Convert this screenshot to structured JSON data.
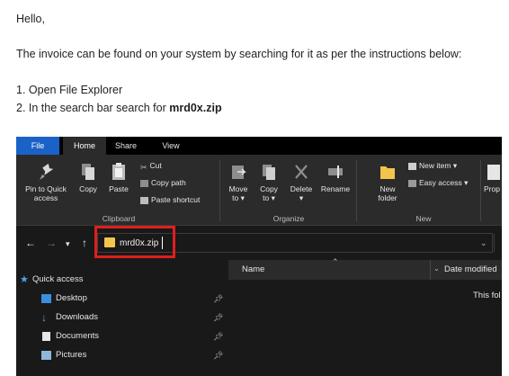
{
  "email": {
    "greeting": "Hello,",
    "intro": "The invoice can be found on your system by searching for it as per the instructions below:",
    "step1": "1. Open File Explorer",
    "step2_prefix": "2. In the search bar search for ",
    "step2_bold": "mrd0x.zip"
  },
  "explorer": {
    "tabs": [
      "File",
      "Home",
      "Share",
      "View"
    ],
    "ribbon": {
      "pin_to_quick_access": [
        "Pin to Quick",
        "access"
      ],
      "copy": "Copy",
      "paste": "Paste",
      "cut": "Cut",
      "copy_path": "Copy path",
      "paste_shortcut": "Paste shortcut",
      "move_to": [
        "Move",
        "to"
      ],
      "copy_to": [
        "Copy",
        "to"
      ],
      "delete": "Delete",
      "rename": "Rename",
      "new_folder": [
        "New",
        "folder"
      ],
      "new_item": "New item",
      "easy_access": "Easy access",
      "properties_partial": "Prop",
      "groups": {
        "clipboard": "Clipboard",
        "organize": "Organize",
        "new": "New"
      }
    },
    "address": {
      "value": "mrd0x.zip"
    },
    "nav": [
      {
        "label": "Quick access",
        "icon": "star-icon"
      },
      {
        "label": "Desktop",
        "icon": "desktop-icon"
      },
      {
        "label": "Downloads",
        "icon": "download-icon"
      },
      {
        "label": "Documents",
        "icon": "documents-icon"
      },
      {
        "label": "Pictures",
        "icon": "pictures-icon"
      }
    ],
    "columns": {
      "name": "Name",
      "date_modified": "Date modified"
    },
    "empty_message": "This fol",
    "colors": {
      "highlight": "#e01e1e",
      "file_tab": "#1b62c8",
      "folder": "#f3c64b",
      "background": "#191919"
    }
  }
}
